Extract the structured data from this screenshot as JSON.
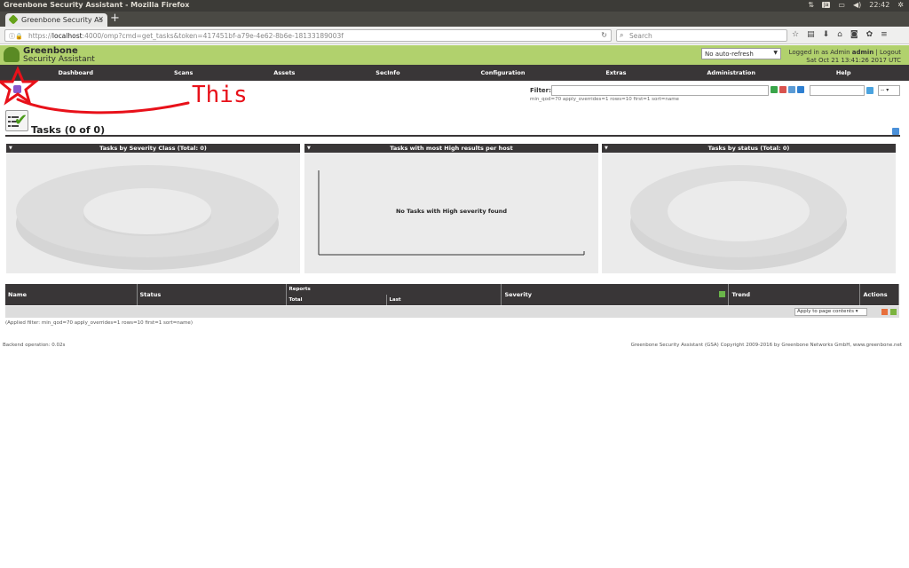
{
  "os": {
    "window_title": "Greenbone Security Assistant - Mozilla Firefox",
    "clock": "22:42",
    "kb_badge": "Ja"
  },
  "browser": {
    "tab_title": "Greenbone Security As",
    "url_prefix": "https://",
    "url_host": "localhost",
    "url_rest": ":4000/omp?cmd=get_tasks&token=417451bf-a79e-4e62-8b6e-18133189003f",
    "search_placeholder": "Search"
  },
  "header": {
    "brand_line1": "Greenbone",
    "brand_line2": "Security Assistant",
    "refresh_value": "No auto-refresh",
    "login_prefix": "Logged in as  Admin ",
    "user": "admin",
    "logout": "Logout",
    "datetime": "Sat Oct 21 13:41:26 2017 UTC"
  },
  "menu": [
    "Dashboard",
    "Scans",
    "Assets",
    "SecInfo",
    "Configuration",
    "Extras",
    "Administration",
    "Help"
  ],
  "toolbar": {
    "filter_label": "Filter:",
    "filter_text": "min_qod=70 apply_overrides=1 rows=10 first=1 sort=name",
    "page_select": "--"
  },
  "annotation": {
    "text": "This"
  },
  "page": {
    "title": "Tasks (0 of 0)"
  },
  "panels": [
    {
      "title": "Tasks by Severity Class (Total: 0)"
    },
    {
      "title": "Tasks with most High results per host",
      "message": "No Tasks with High severity found"
    },
    {
      "title": "Tasks by status (Total: 0)"
    }
  ],
  "table": {
    "col_name": "Name",
    "col_status": "Status",
    "col_reports": "Reports",
    "col_total": "Total",
    "col_last": "Last",
    "col_severity": "Severity",
    "col_trend": "Trend",
    "col_actions": "Actions",
    "apply_select": "Apply to page contents"
  },
  "footer": {
    "applied_filter": "(Applied filter: min_qod=70 apply_overrides=1 rows=10 first=1 sort=name)",
    "backend": "Backend operation: 0.02s",
    "copyright": "Greenbone Security Assistant (GSA) Copyright 2009-2016 by Greenbone Networks GmbH, www.greenbone.net"
  }
}
